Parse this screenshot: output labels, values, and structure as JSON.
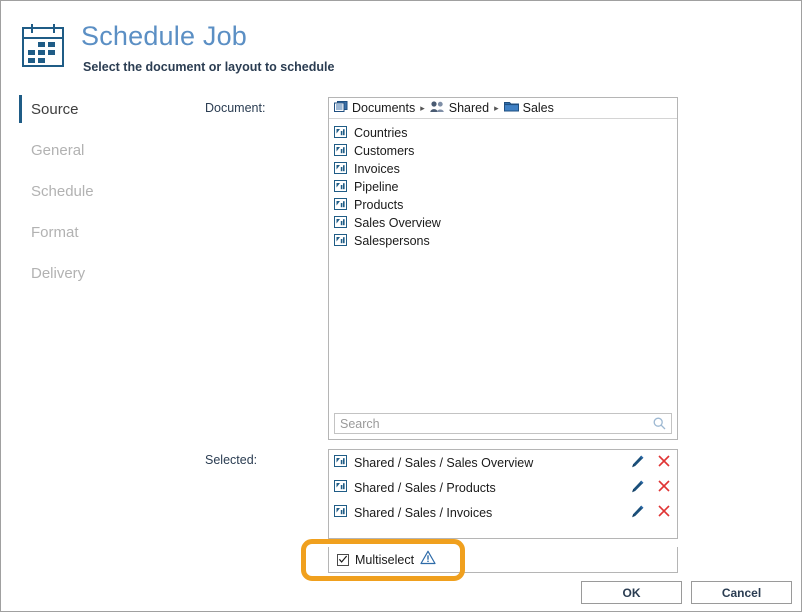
{
  "header": {
    "title": "Schedule Job",
    "subtitle": "Select the document or layout to schedule",
    "icon": "calendar-icon",
    "title_color": "#5b8fc4"
  },
  "sidebar": {
    "items": [
      {
        "label": "Source",
        "active": true
      },
      {
        "label": "General",
        "active": false
      },
      {
        "label": "Schedule",
        "active": false
      },
      {
        "label": "Format",
        "active": false
      },
      {
        "label": "Delivery",
        "active": false
      }
    ],
    "active_color": "#1f5c86",
    "inactive_color": "#b2b2b2"
  },
  "form": {
    "document_label": "Document:",
    "selected_label": "Selected:"
  },
  "document_panel": {
    "breadcrumb": [
      {
        "label": "Documents",
        "icon": "documents-icon"
      },
      {
        "label": "Shared",
        "icon": "users-icon"
      },
      {
        "label": "Sales",
        "icon": "folder-icon"
      }
    ],
    "breadcrumb_separator": "▸",
    "items": [
      {
        "label": "Countries",
        "icon": "report-icon"
      },
      {
        "label": "Customers",
        "icon": "report-icon"
      },
      {
        "label": "Invoices",
        "icon": "report-icon"
      },
      {
        "label": "Pipeline",
        "icon": "report-icon"
      },
      {
        "label": "Products",
        "icon": "report-icon"
      },
      {
        "label": "Sales Overview",
        "icon": "report-icon"
      },
      {
        "label": "Salespersons",
        "icon": "report-icon"
      }
    ],
    "search": {
      "value": "",
      "placeholder": "Search",
      "icon": "search-icon"
    }
  },
  "selected_panel": {
    "items": [
      {
        "label": "Shared / Sales / Sales Overview",
        "icon": "report-icon",
        "edit_icon": "pencil-icon",
        "remove_icon": "close-icon"
      },
      {
        "label": "Shared / Sales / Products",
        "icon": "report-icon",
        "edit_icon": "pencil-icon",
        "remove_icon": "close-icon"
      },
      {
        "label": "Shared / Sales / Invoices",
        "icon": "report-icon",
        "edit_icon": "pencil-icon",
        "remove_icon": "close-icon"
      }
    ],
    "edit_color": "#1f5c86",
    "remove_color": "#e03434"
  },
  "multiselect": {
    "label": "Multiselect",
    "checked": true,
    "check_glyph": "✓",
    "warning_icon": "warning-triangle-icon",
    "highlight_color": "#f0a01e"
  },
  "buttons": {
    "ok": "OK",
    "cancel": "Cancel"
  }
}
